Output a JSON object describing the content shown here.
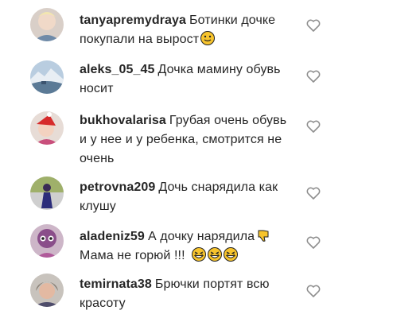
{
  "comments": [
    {
      "username": "tanyapremydraya",
      "text_line1": "Ботинки",
      "text_rest": "дочке покупали на вырост",
      "emoji": "slightly-smiling-face-emoji"
    },
    {
      "username": "aleks_05_45",
      "text_line1": "Дочка мамину",
      "text_rest": "обувь носит"
    },
    {
      "username": "bukhovalarisa",
      "text_line1": "Грубая очень",
      "text_rest": "обувь и у нее и у ребенка, смотрится не очень"
    },
    {
      "username": "petrovna209",
      "text_line1": "Дочь снарядила",
      "text_rest": "как клушу"
    },
    {
      "username": "aladeniz59",
      "text_line1": "А дочку нарядила",
      "text_rest": "Мама не горюй !!!",
      "emoji": "thumbs-down-emoji",
      "emoji_tail": "grinning-squinting-face-emoji x3"
    },
    {
      "username": "temirnata38",
      "text_line1": "Брючки портят всю",
      "text_rest": "красоту"
    }
  ],
  "icons": {
    "like": "heart-outline-icon"
  },
  "colors": {
    "text": "#262626",
    "heart": "#8e8e8e",
    "emoji_yellow": "#f7c42d"
  }
}
